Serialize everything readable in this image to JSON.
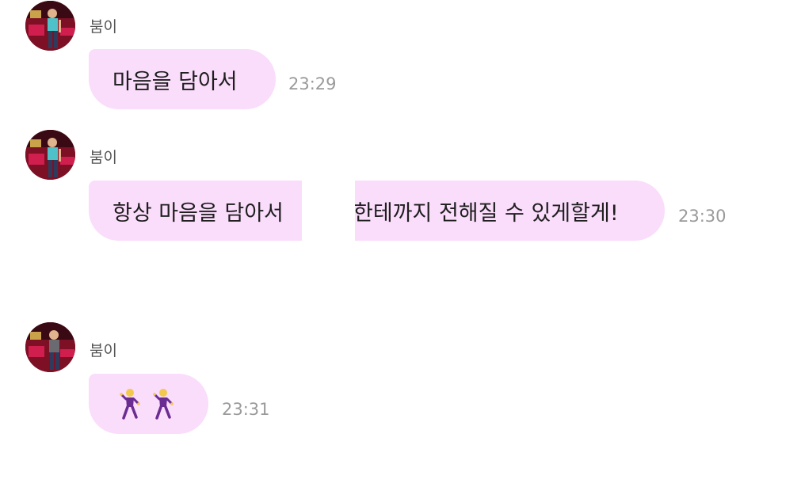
{
  "messages": [
    {
      "sender": "붐이",
      "text": "마음을 담아서",
      "time": "23:29"
    },
    {
      "sender": "붐이",
      "text_before": "항상 마음을 담아서",
      "text_after": "한테까지 전해질 수 있게할게!",
      "time": "23:30"
    },
    {
      "sender": "붐이",
      "emoji": [
        "dancing-man-emoji",
        "dancing-man-emoji"
      ],
      "time": "23:31"
    }
  ],
  "colors": {
    "bubble": "#fadcfb",
    "text": "#1e1e1e",
    "time": "#9a9a9a",
    "sender": "#555555"
  }
}
